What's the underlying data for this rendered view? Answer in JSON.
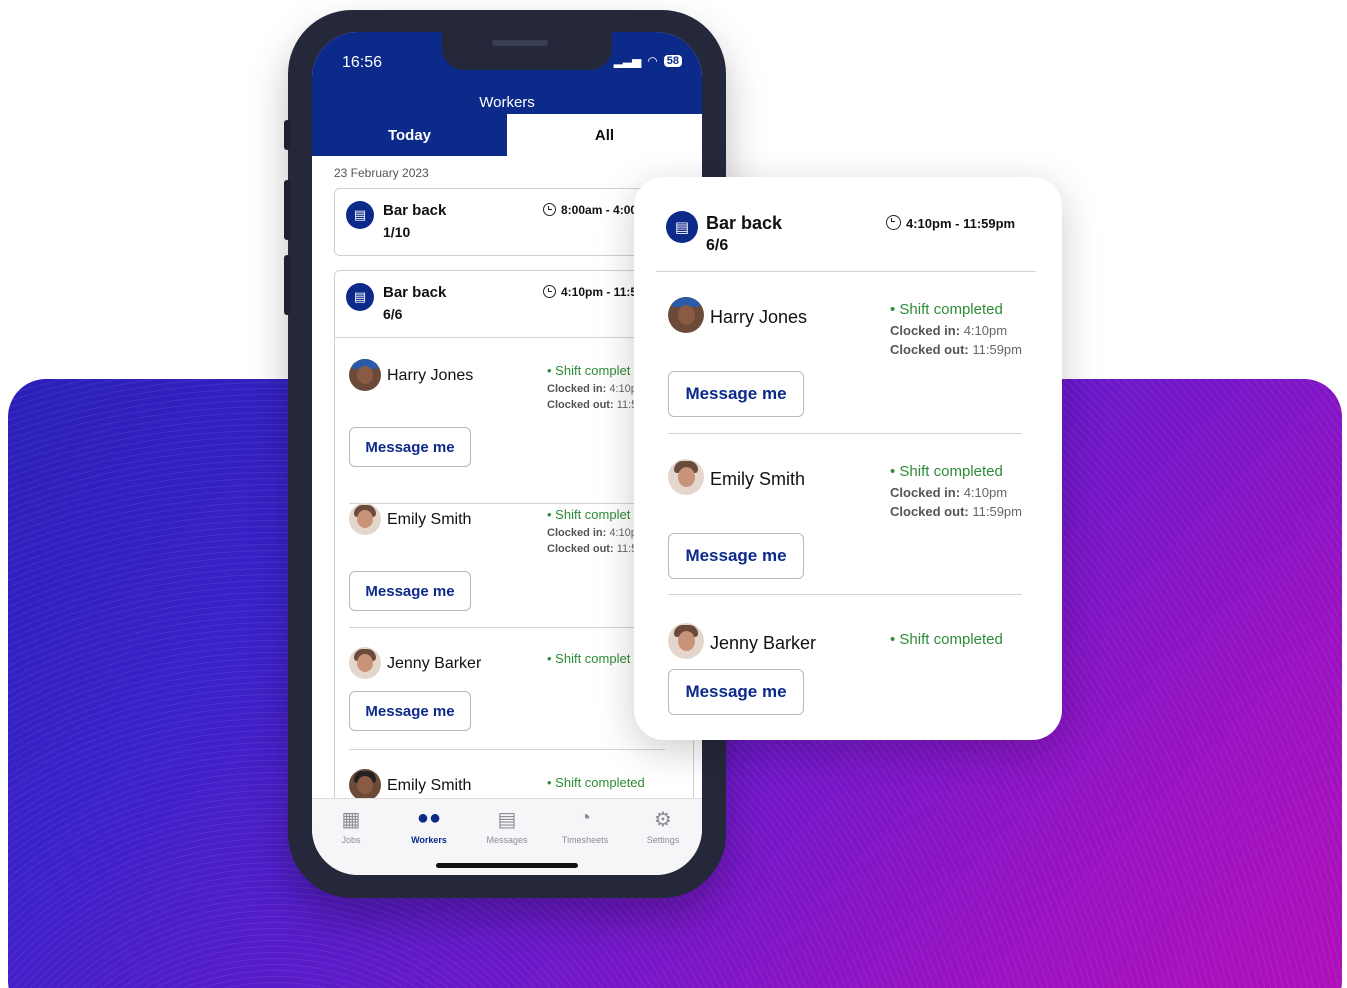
{
  "status_bar": {
    "time": "16:56",
    "battery": "58"
  },
  "app": {
    "title": "Workers"
  },
  "tabs": [
    {
      "label": "Today"
    },
    {
      "label": "All"
    }
  ],
  "date": "23 February 2023",
  "jobs": [
    {
      "title": "Bar back",
      "count": "1/10",
      "time": "8:00am - 4:00"
    },
    {
      "title": "Bar back",
      "count": "6/6",
      "time": "4:10pm - 11:5"
    }
  ],
  "workers": [
    {
      "name": "Harry Jones",
      "status": "• Shift complet",
      "clocked_in_label": "Clocked in:",
      "clocked_in": "4:10p",
      "clocked_out_label": "Clocked out:",
      "clocked_out": "11:5",
      "button": "Message me"
    },
    {
      "name": "Emily Smith",
      "status": "• Shift complet",
      "clocked_in_label": "Clocked in:",
      "clocked_in": "4:10p",
      "clocked_out_label": "Clocked out:",
      "clocked_out": "11:5",
      "button": "Message me"
    },
    {
      "name": "Jenny Barker",
      "status": "• Shift complet",
      "button": "Message me"
    },
    {
      "name": "Emily Smith",
      "status": "• Shift completed"
    }
  ],
  "bottom_nav": [
    {
      "label": "Jobs",
      "icon": "calendar-icon"
    },
    {
      "label": "Workers",
      "icon": "people-icon"
    },
    {
      "label": "Messages",
      "icon": "chat-icon"
    },
    {
      "label": "Timesheets",
      "icon": "stopwatch-icon"
    },
    {
      "label": "Settings",
      "icon": "gear-icon"
    }
  ],
  "zoom": {
    "job_title": "Bar back",
    "job_count": "6/6",
    "job_time": "4:10pm - 11:59pm",
    "workers": [
      {
        "name": "Harry Jones",
        "status": "• Shift completed",
        "clocked_in_label": "Clocked in:",
        "clocked_in": "4:10pm",
        "clocked_out_label": "Clocked out:",
        "clocked_out": "11:59pm",
        "button": "Message me"
      },
      {
        "name": "Emily Smith",
        "status": "• Shift completed",
        "clocked_in_label": "Clocked in:",
        "clocked_in": "4:10pm",
        "clocked_out_label": "Clocked out:",
        "clocked_out": "11:59pm",
        "button": "Message me"
      },
      {
        "name": "Jenny Barker",
        "status": "• Shift completed",
        "button": "Message me"
      }
    ]
  },
  "colors": {
    "brand": "#0b2a8a",
    "success": "#2e8b36",
    "bg_gradient_start": "#2b1fb8",
    "bg_gradient_end": "#b010b8"
  }
}
